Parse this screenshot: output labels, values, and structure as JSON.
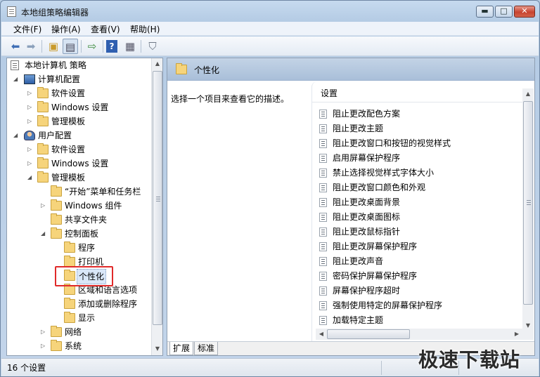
{
  "window": {
    "title": "本地组策略编辑器",
    "minimize": "▬",
    "maximize": "□",
    "close": "✕"
  },
  "menu": [
    "文件(F)",
    "操作(A)",
    "查看(V)",
    "帮助(H)"
  ],
  "toolbar_icons": [
    "back-arrow-icon",
    "forward-arrow-icon",
    "up-folder-icon",
    "show-hide-tree-icon",
    "export-list-icon",
    "help-icon",
    "properties-icon",
    "filter-icon"
  ],
  "tree": {
    "root": "本地计算机 策略",
    "computer_config": "计算机配置",
    "cc_software": "软件设置",
    "cc_windows": "Windows 设置",
    "cc_admin": "管理模板",
    "user_config": "用户配置",
    "uc_software": "软件设置",
    "uc_windows": "Windows 设置",
    "uc_admin": "管理模板",
    "start_menu": "“开始”菜单和任务栏",
    "win_components": "Windows 组件",
    "shared_folders": "共享文件夹",
    "control_panel": "控制面板",
    "programs": "程序",
    "printers": "打印机",
    "personalization": "个性化",
    "region_language": "区域和语言选项",
    "add_remove": "添加或删除程序",
    "display": "显示",
    "network": "网络",
    "system": "系统"
  },
  "right": {
    "header": "个性化",
    "description": "选择一个项目来查看它的描述。",
    "column_header": "设置",
    "settings": [
      "阻止更改配色方案",
      "阻止更改主题",
      "阻止更改窗口和按钮的视觉样式",
      "启用屏幕保护程序",
      "禁止选择视觉样式字体大小",
      "阻止更改窗口颜色和外观",
      "阻止更改桌面背景",
      "阻止更改桌面图标",
      "阻止更改鼠标指针",
      "阻止更改屏幕保护程序",
      "阻止更改声音",
      "密码保护屏幕保护程序",
      "屏幕保护程序超时",
      "强制使用特定的屏幕保护程序",
      "加载特定主题"
    ],
    "tabs": [
      "扩展",
      "标准"
    ]
  },
  "status": {
    "text": "16 个设置"
  },
  "watermark": "极速下载站",
  "colors": {
    "highlight": "#e02a2a",
    "header": "#b4c8e0"
  }
}
